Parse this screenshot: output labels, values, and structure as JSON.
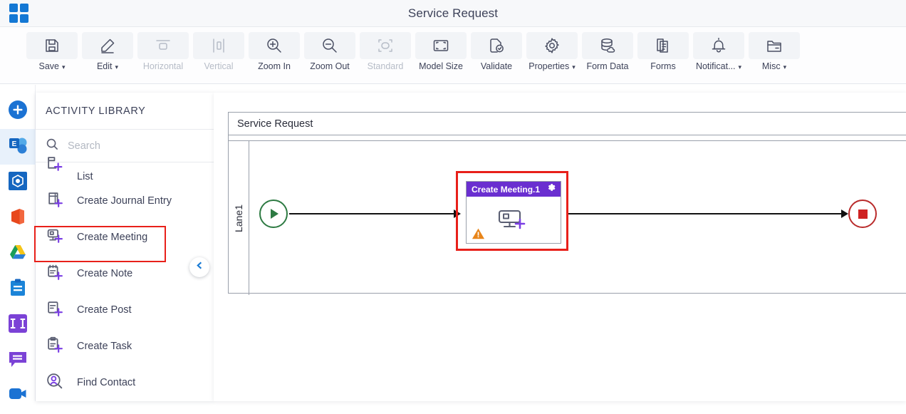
{
  "titlebar": {
    "app_grid_icon": "app-grid-icon",
    "title": "Service Request"
  },
  "toolbar": {
    "items": [
      {
        "label": "Save",
        "icon": "save-icon",
        "caret": "⌄",
        "disabled": false
      },
      {
        "label": "Edit",
        "icon": "edit-pencil-icon",
        "caret": "⌄",
        "disabled": false
      },
      {
        "label": "Horizontal",
        "icon": "horizontal-layout-icon",
        "caret": "",
        "disabled": true
      },
      {
        "label": "Vertical",
        "icon": "vertical-layout-icon",
        "caret": "",
        "disabled": true
      },
      {
        "label": "Zoom In",
        "icon": "zoom-in-icon",
        "caret": "",
        "disabled": false
      },
      {
        "label": "Zoom Out",
        "icon": "zoom-out-icon",
        "caret": "",
        "disabled": false
      },
      {
        "label": "Standard",
        "icon": "standard-size-icon",
        "caret": "",
        "disabled": true
      },
      {
        "label": "Model Size",
        "icon": "model-size-icon",
        "caret": "",
        "disabled": false
      },
      {
        "label": "Validate",
        "icon": "validate-icon",
        "caret": "",
        "disabled": false
      },
      {
        "label": "Properties",
        "icon": "gear-icon",
        "caret": "⌄",
        "disabled": false
      },
      {
        "label": "Form Data",
        "icon": "database-icon",
        "caret": "",
        "disabled": false
      },
      {
        "label": "Forms",
        "icon": "forms-icon",
        "caret": "",
        "disabled": false
      },
      {
        "label": "Notificat...",
        "icon": "bell-icon",
        "caret": "⌄",
        "disabled": false
      },
      {
        "label": "Misc",
        "icon": "folder-icon",
        "caret": "⌄",
        "disabled": false
      }
    ]
  },
  "rail": {
    "items": [
      {
        "name": "add-button",
        "icon": "plus-circle-icon",
        "color": "#1b72d3",
        "active": false
      },
      {
        "name": "exchange-app",
        "icon": "exchange-icon",
        "color": "#2c7fd6",
        "active": true
      },
      {
        "name": "dynamics-app",
        "icon": "dynamics-icon",
        "color": "#1566c0",
        "active": false
      },
      {
        "name": "office-app",
        "icon": "office-icon",
        "color": "#e8481c",
        "active": false
      },
      {
        "name": "google-drive-app",
        "icon": "google-drive-icon",
        "color": "#0f9d58",
        "active": false
      },
      {
        "name": "clipboard-app",
        "icon": "clipboard-icon",
        "color": "#1b84d8",
        "active": false
      },
      {
        "name": "columns-app",
        "icon": "columns-icon",
        "color": "#7b42d6",
        "active": false
      },
      {
        "name": "chat-app",
        "icon": "chat-icon",
        "color": "#7b42d6",
        "active": false
      },
      {
        "name": "video-app",
        "icon": "video-camera-icon",
        "color": "#1b72d3",
        "active": false
      }
    ]
  },
  "library": {
    "title": "ACTIVITY LIBRARY",
    "search": {
      "placeholder": "Search",
      "value": "",
      "icon": "search-icon"
    },
    "items": [
      {
        "label": "List",
        "icon": "create-list-icon",
        "clipped": true,
        "highlighted": false
      },
      {
        "label": "Create Journal Entry",
        "icon": "create-journal-icon",
        "clipped": false,
        "highlighted": false
      },
      {
        "label": "Create Meeting",
        "icon": "create-meeting-icon",
        "clipped": false,
        "highlighted": true
      },
      {
        "label": "Create Note",
        "icon": "create-note-icon",
        "clipped": false,
        "highlighted": false
      },
      {
        "label": "Create Post",
        "icon": "create-post-icon",
        "clipped": false,
        "highlighted": false
      },
      {
        "label": "Create Task",
        "icon": "create-task-icon",
        "clipped": false,
        "highlighted": false
      },
      {
        "label": "Find Contact",
        "icon": "find-contact-icon",
        "clipped": false,
        "highlighted": false
      }
    ],
    "collapse_icon": "chevron-left-icon",
    "highlight_color": "#e8201a"
  },
  "canvas": {
    "pool_title": "Service Request",
    "lane_label": "Lane1",
    "start_event": {
      "name": "start-event",
      "icon": "play-triangle-icon",
      "color": "#2d7a42"
    },
    "end_event": {
      "name": "end-event",
      "icon": "stop-square-icon",
      "color": "#b92b2b"
    },
    "task": {
      "title": "Create Meeting.1",
      "header_color": "#6a2fd0",
      "gear_icon": "gear-icon",
      "body_icon": "create-meeting-icon",
      "warning_icon": "warning-triangle-icon",
      "selected": true,
      "selection_color": "#e8201a"
    }
  }
}
